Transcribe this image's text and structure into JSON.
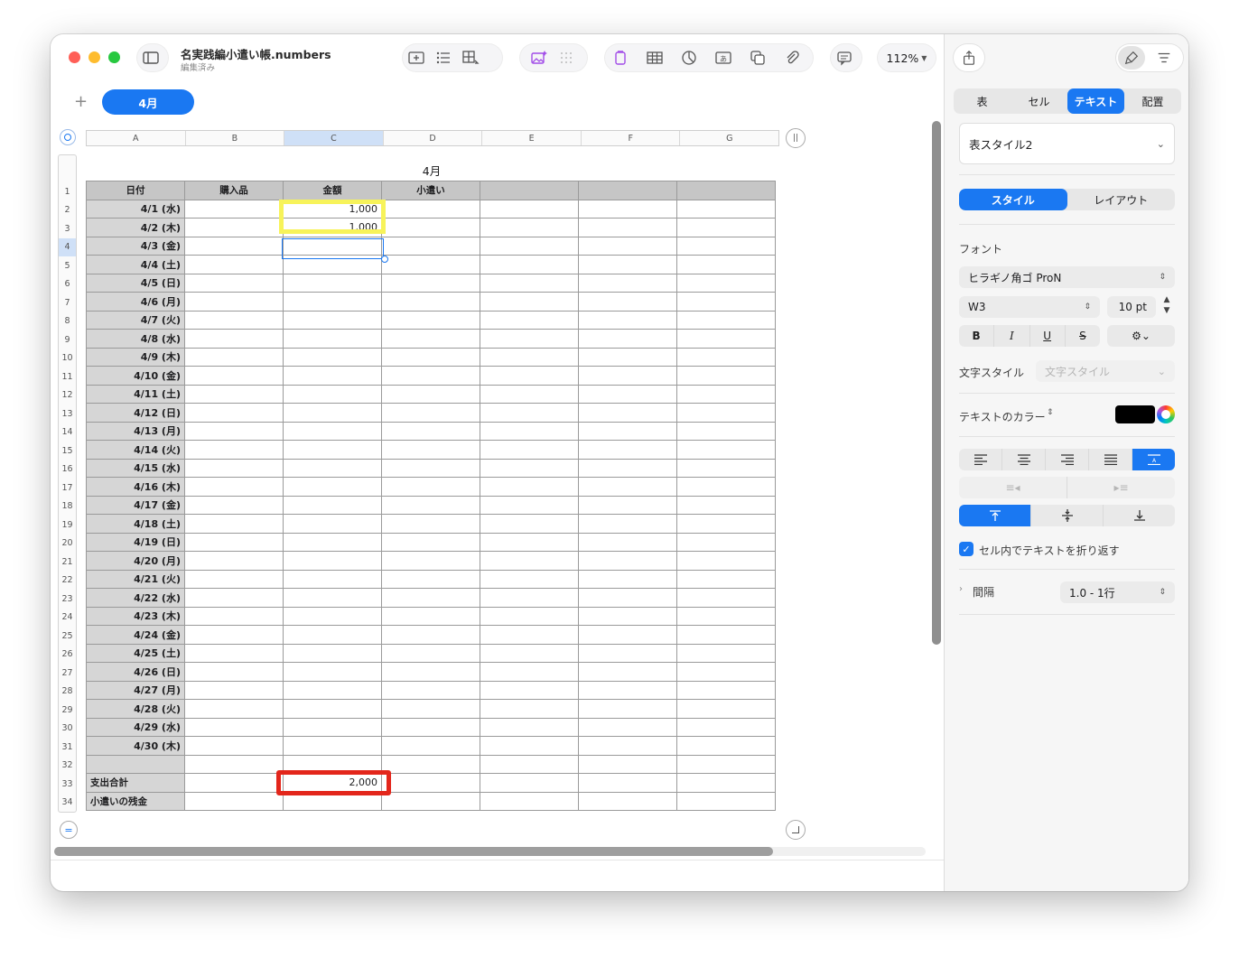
{
  "window": {
    "doc_title": "名実践編小遣い帳.numbers",
    "doc_status": "編集済み",
    "zoom": "112%"
  },
  "sheet": {
    "tabs": [
      {
        "label": "4月",
        "active": true
      }
    ],
    "column_letters": [
      "A",
      "B",
      "C",
      "D",
      "E",
      "F",
      "G"
    ],
    "selected_column": "C",
    "row_numbers": [
      "1",
      "2",
      "3",
      "4",
      "5",
      "6",
      "7",
      "8",
      "9",
      "10",
      "11",
      "12",
      "13",
      "14",
      "15",
      "16",
      "17",
      "18",
      "19",
      "20",
      "21",
      "22",
      "23",
      "24",
      "25",
      "26",
      "27",
      "28",
      "29",
      "30",
      "31",
      "32",
      "33",
      "34"
    ],
    "selected_row": "4"
  },
  "table": {
    "title": "4月",
    "headers": [
      "日付",
      "購入品",
      "金額",
      "小遣い",
      "",
      "",
      ""
    ],
    "rows": [
      [
        "4/1 (水)",
        "",
        "1,000",
        ""
      ],
      [
        "4/2 (木)",
        "",
        "1,000",
        ""
      ],
      [
        "4/3 (金)",
        "",
        "",
        ""
      ],
      [
        "4/4 (土)",
        "",
        "",
        ""
      ],
      [
        "4/5 (日)",
        "",
        "",
        ""
      ],
      [
        "4/6 (月)",
        "",
        "",
        ""
      ],
      [
        "4/7 (火)",
        "",
        "",
        ""
      ],
      [
        "4/8 (水)",
        "",
        "",
        ""
      ],
      [
        "4/9 (木)",
        "",
        "",
        ""
      ],
      [
        "4/10 (金)",
        "",
        "",
        ""
      ],
      [
        "4/11 (土)",
        "",
        "",
        ""
      ],
      [
        "4/12 (日)",
        "",
        "",
        ""
      ],
      [
        "4/13 (月)",
        "",
        "",
        ""
      ],
      [
        "4/14 (火)",
        "",
        "",
        ""
      ],
      [
        "4/15 (水)",
        "",
        "",
        ""
      ],
      [
        "4/16 (木)",
        "",
        "",
        ""
      ],
      [
        "4/17 (金)",
        "",
        "",
        ""
      ],
      [
        "4/18 (土)",
        "",
        "",
        ""
      ],
      [
        "4/19 (日)",
        "",
        "",
        ""
      ],
      [
        "4/20 (月)",
        "",
        "",
        ""
      ],
      [
        "4/21 (火)",
        "",
        "",
        ""
      ],
      [
        "4/22 (水)",
        "",
        "",
        ""
      ],
      [
        "4/23 (木)",
        "",
        "",
        ""
      ],
      [
        "4/24 (金)",
        "",
        "",
        ""
      ],
      [
        "4/25 (土)",
        "",
        "",
        ""
      ],
      [
        "4/26 (日)",
        "",
        "",
        ""
      ],
      [
        "4/27 (月)",
        "",
        "",
        ""
      ],
      [
        "4/28 (火)",
        "",
        "",
        ""
      ],
      [
        "4/29 (水)",
        "",
        "",
        ""
      ],
      [
        "4/30 (木)",
        "",
        "",
        ""
      ],
      [
        "",
        "",
        "",
        ""
      ]
    ],
    "footer": [
      [
        "支出合計",
        "",
        "2,000",
        ""
      ],
      [
        "小遣いの残金",
        "",
        "",
        ""
      ]
    ]
  },
  "highlights": {
    "yellow": "#f7f35a",
    "red": "#e3261b"
  },
  "inspector": {
    "tabs": [
      "表",
      "セル",
      "テキスト",
      "配置"
    ],
    "active_tab": "テキスト",
    "table_style": "表スタイル2",
    "subtabs": [
      "スタイル",
      "レイアウト"
    ],
    "active_subtab": "スタイル",
    "font_label": "フォント",
    "font_family": "ヒラギノ角ゴ ProN",
    "font_weight": "W3",
    "font_size": "10 pt",
    "format_buttons": [
      "B",
      "I",
      "U",
      "S"
    ],
    "char_style_label": "文字スタイル",
    "char_style_placeholder": "文字スタイル",
    "text_color_label": "テキストのカラー",
    "text_color": "#000000",
    "wrap_label": "セル内でテキストを折り返す",
    "wrap_checked": true,
    "spacing_label": "間隔",
    "spacing_value": "1.0 - 1行"
  },
  "colors": {
    "accent": "#1a78f2"
  }
}
